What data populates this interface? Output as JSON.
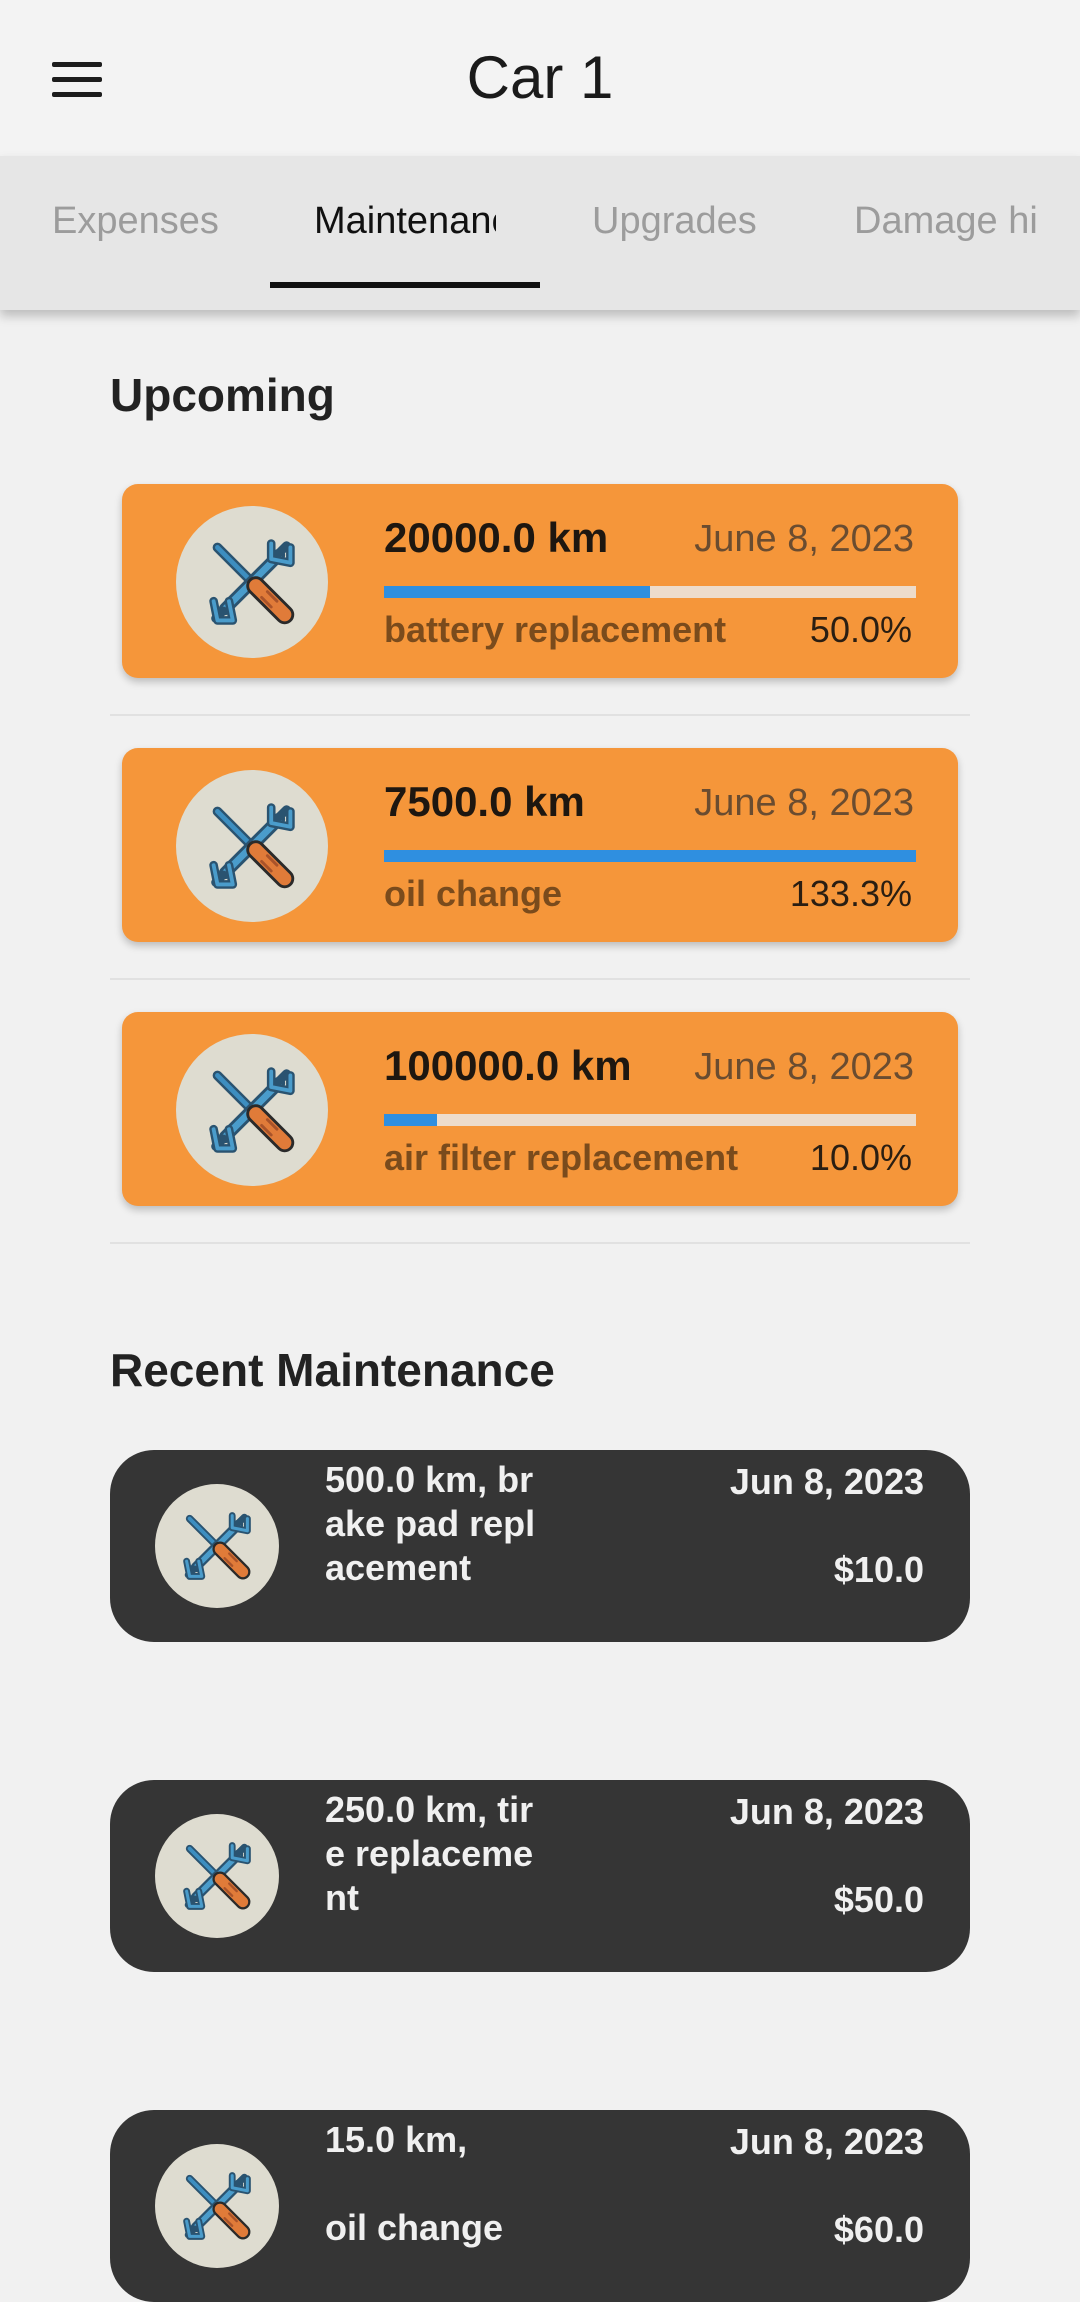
{
  "app_bar": {
    "title": "Car 1"
  },
  "tabs": [
    {
      "label": "Expenses",
      "active": false
    },
    {
      "label": "Maintenance",
      "active": true
    },
    {
      "label": "Upgrades",
      "active": false
    },
    {
      "label": "Damage history",
      "active": false
    }
  ],
  "upcoming": {
    "title": "Upcoming",
    "items": [
      {
        "km": "20000.0 km",
        "date": "June 8, 2023",
        "name": "battery replacement",
        "percent": "50.0%",
        "progress": 0.5
      },
      {
        "km": "7500.0 km",
        "date": "June 8, 2023",
        "name": "oil change",
        "percent": "133.3%",
        "progress": 1.0
      },
      {
        "km": "100000.0 km",
        "date": "June 8, 2023",
        "name": "air filter replacement",
        "percent": "10.0%",
        "progress": 0.1
      }
    ]
  },
  "recent": {
    "title": "Recent Maintenance",
    "items": [
      {
        "description": "500.0 km, brake pad replacement",
        "date": "Jun 8, 2023",
        "cost": "$10.0"
      },
      {
        "description": "250.0 km, tire replacement",
        "date": "Jun 8, 2023",
        "cost": "$50.0"
      },
      {
        "description": "15.0 km,\n\noil change",
        "date": "Jun 8, 2023",
        "cost": "$60.0"
      }
    ]
  },
  "icons": {
    "menu": "hamburger-menu-icon",
    "maintenance": "wrench-screwdriver-icon"
  },
  "colors": {
    "upcoming_card": "#f5963a",
    "progress_fill": "#2f8fe0",
    "recent_card": "#353535",
    "icon_circle": "#dedcd0"
  }
}
